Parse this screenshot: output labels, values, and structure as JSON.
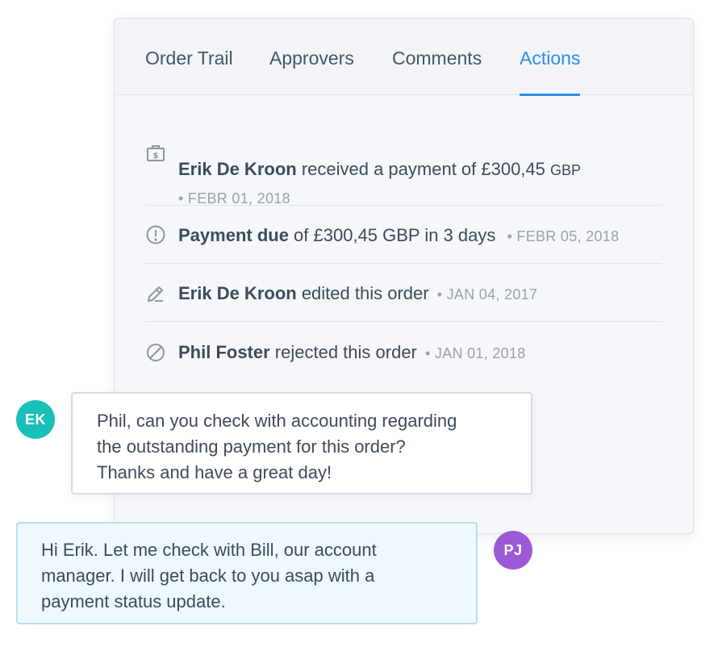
{
  "tabs": [
    {
      "label": "Order Trail",
      "active": false
    },
    {
      "label": "Approvers",
      "active": false
    },
    {
      "label": "Comments",
      "active": false
    },
    {
      "label": "Actions",
      "active": true
    }
  ],
  "activity": [
    {
      "icon": "payment-bag-icon",
      "actor": "Erik De Kroon",
      "text": " received a payment of £300,45 ",
      "suffix": "GBP",
      "date": "• FEBR 01, 2018"
    },
    {
      "icon": "alert-circle-icon",
      "actor": "Payment due",
      "text": " of £300,45 GBP in 3 days",
      "date": "• FEBR 05, 2018"
    },
    {
      "icon": "pencil-icon",
      "actor": "Erik De Kroon",
      "text": " edited this order",
      "date": "• JAN 04, 2017"
    },
    {
      "icon": "blocked-icon",
      "actor": "Phil Foster",
      "text": " rejected this order",
      "date": "• JAN 01, 2018"
    }
  ],
  "messages": [
    {
      "initials": "EK",
      "avatar_color": "#1bbfb9",
      "lines": [
        "Phil, can you check with accounting regarding",
        "the outstanding payment for this order?",
        "Thanks and have a great day!"
      ]
    },
    {
      "initials": "PJ",
      "avatar_color": "#9b59d6",
      "lines": [
        "Hi Erik. Let me check with Bill, our account",
        "manager. I will get back to you asap with a",
        "payment status update."
      ]
    }
  ],
  "colors": {
    "accent": "#2f8ee5",
    "text": "#3d4b5c",
    "muted": "#98a2ae"
  }
}
